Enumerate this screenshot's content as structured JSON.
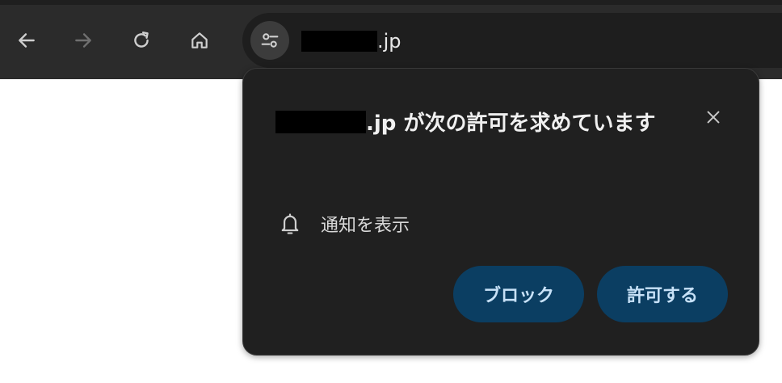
{
  "toolbar": {
    "back_icon": "arrow-left-icon",
    "forward_icon": "arrow-right-icon",
    "reload_icon": "reload-icon",
    "home_icon": "home-icon"
  },
  "omnibox": {
    "site_info_icon": "tune-icon",
    "url_suffix": ".jp"
  },
  "popup": {
    "title_suffix": ".jp が次の許可を求めています",
    "close_icon": "close-icon",
    "permission": {
      "icon": "bell-icon",
      "label": "通知を表示"
    },
    "buttons": {
      "block": "ブロック",
      "allow": "許可する"
    }
  },
  "colors": {
    "toolbar_bg": "#2b2b2b",
    "omnibox_bg": "#1e1e1e",
    "popup_bg": "#202020",
    "button_bg": "#0b3e62",
    "button_text": "#c7e1f7"
  }
}
